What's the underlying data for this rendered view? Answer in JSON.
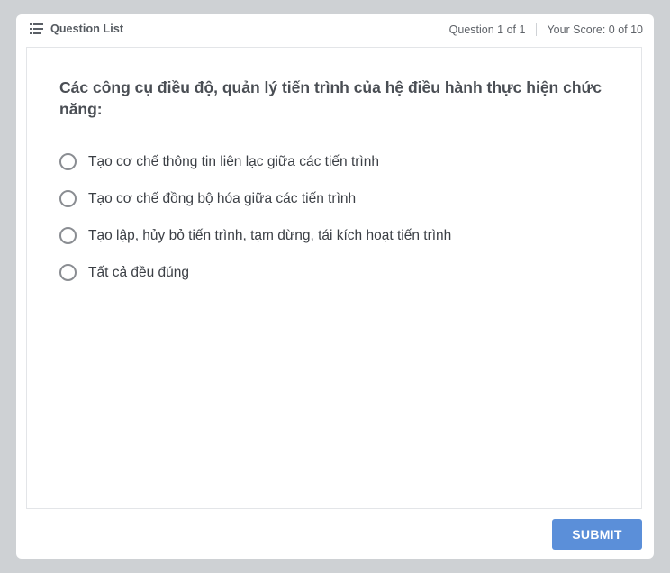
{
  "header": {
    "question_list_label": "Question List",
    "question_counter": "Question 1 of 1",
    "score": "Your Score: 0 of 10"
  },
  "question": {
    "text": "Các công cụ điều độ, quản lý tiến trình của hệ điều hành thực hiện chức năng:",
    "options": [
      {
        "label": "Tạo cơ chế thông tin liên lạc giữa các tiến trình"
      },
      {
        "label": "Tạo cơ chế đồng bộ hóa giữa các tiến trình"
      },
      {
        "label": "Tạo lập, hủy bỏ tiến trình, tạm dừng, tái kích hoạt tiến trình"
      },
      {
        "label": "Tất cả đều đúng"
      }
    ]
  },
  "actions": {
    "submit_label": "SUBMIT"
  },
  "colors": {
    "accent": "#5b8fd9",
    "background": "#ced1d4"
  }
}
